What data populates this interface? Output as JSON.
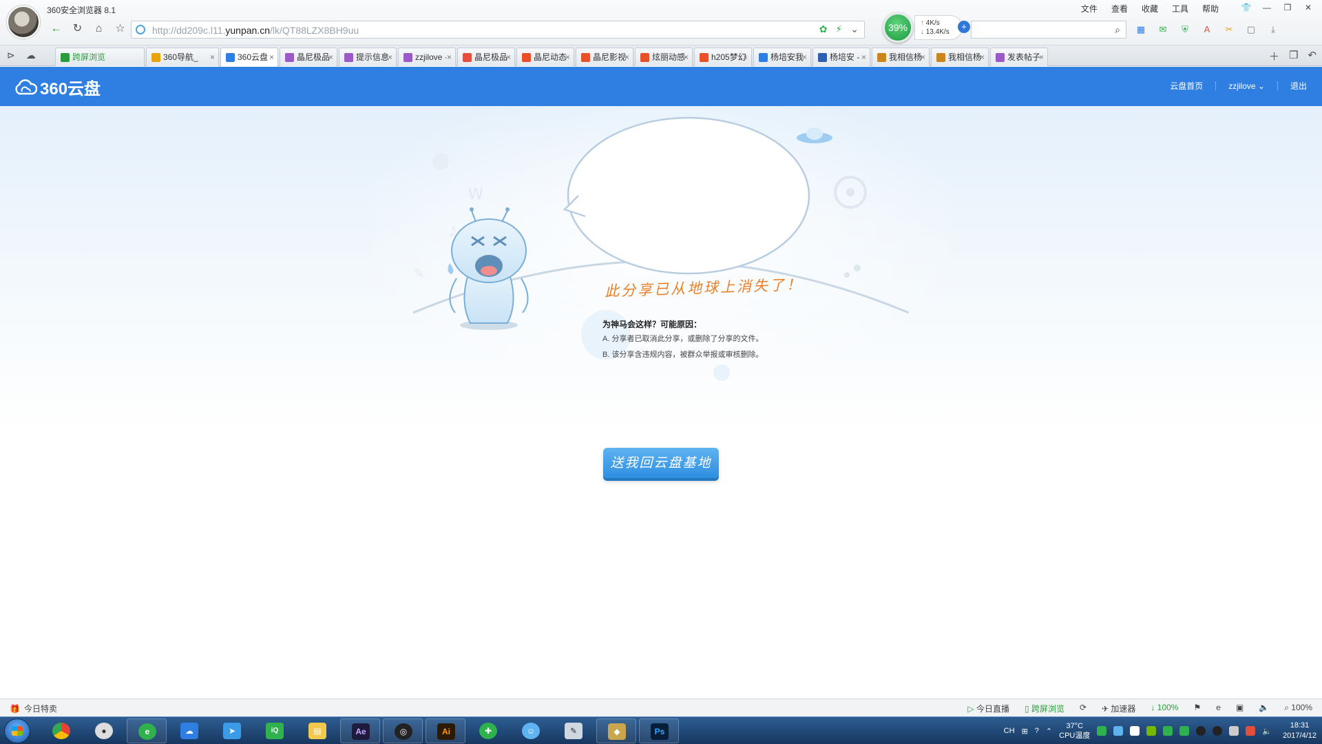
{
  "browser": {
    "app_title": "360安全浏览器 8.1",
    "menu": [
      "文件",
      "查看",
      "收藏",
      "工具",
      "帮助"
    ],
    "address": {
      "prefix": "http://dd209c.l11.",
      "domain": "yunpan.cn",
      "path": "/lk/QT88LZX8BH9uu"
    },
    "net": {
      "percent": "39%",
      "up": "4K/s",
      "down": "13.4K/s"
    }
  },
  "tabs": [
    {
      "label": "跨屏浏览",
      "color": "#2a9d3b"
    },
    {
      "label": "360导航_",
      "color": "#e8a20c"
    },
    {
      "label": "360云盘",
      "color": "#2f7ee2",
      "active": true
    },
    {
      "label": "晶尼极品",
      "color": "#9b5ac8"
    },
    {
      "label": "提示信息",
      "color": "#9b5ac8"
    },
    {
      "label": "zzjilove ·",
      "color": "#9b5ac8"
    },
    {
      "label": "晶尼极品",
      "color": "#e34f3c"
    },
    {
      "label": "晶尼动态",
      "color": "#e8502a"
    },
    {
      "label": "晶尼影视",
      "color": "#e8502a"
    },
    {
      "label": "炫丽动感",
      "color": "#e8502a"
    },
    {
      "label": "h205梦幻",
      "color": "#e8502a"
    },
    {
      "label": "杨培安我",
      "color": "#2f7ee2"
    },
    {
      "label": "杨培安 - ",
      "color": "#2f5fb0"
    },
    {
      "label": "我相信杨",
      "color": "#c9861c"
    },
    {
      "label": "我相信杨",
      "color": "#c9861c"
    },
    {
      "label": "发表帖子",
      "color": "#9b5ac8"
    }
  ],
  "page": {
    "logo_text": "360云盘",
    "nav": {
      "home": "云盘首页",
      "user": "zzjilove",
      "logout": "退出"
    },
    "bubble": {
      "title": "此分享已从地球上消失了！",
      "question": "为神马会这样？可能原因：",
      "reason_a": "A. 分享者已取消此分享，或删除了分享的文件。",
      "reason_b": "B. 该分享含违规内容，被群众举报或审核删除。"
    },
    "home_button": "送我回云盘基地"
  },
  "statusbar": {
    "left": "今日特卖",
    "right": [
      "今日直播",
      "跨屏浏览",
      "加速器",
      "100%",
      "100%"
    ]
  },
  "taskbar": {
    "lang": "CH",
    "temp": "37°C",
    "temp_label": "CPU温度",
    "time": "18:31",
    "date": "2017/4/12"
  }
}
